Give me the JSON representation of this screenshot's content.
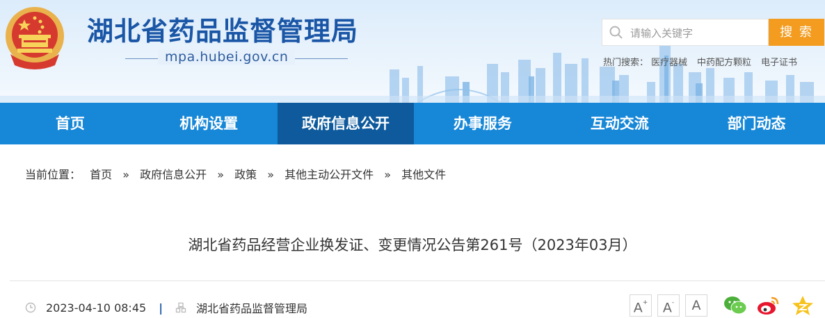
{
  "header": {
    "site_title": "湖北省药品监督管理局",
    "site_url": "mpa.hubei.gov.cn"
  },
  "search": {
    "placeholder": "请输入关键字",
    "button_label": "搜 索",
    "hot_label": "热门搜索：",
    "hot_items": [
      "医疗器械",
      "中药配方颗粒",
      "电子证书"
    ]
  },
  "nav": {
    "items": [
      {
        "label": "首页"
      },
      {
        "label": "机构设置"
      },
      {
        "label": "政府信息公开"
      },
      {
        "label": "办事服务"
      },
      {
        "label": "互动交流"
      },
      {
        "label": "部门动态"
      }
    ],
    "active": "政府信息公开"
  },
  "breadcrumb": {
    "prefix": "当前位置：",
    "separator": "»",
    "items": [
      "首页",
      "政府信息公开",
      "政策",
      "其他主动公开文件",
      "其他文件"
    ]
  },
  "article": {
    "title": "湖北省药品经营企业换发证、变更情况公告第261号（2023年03月）",
    "date": "2023-04-10 08:45",
    "meta_separator": "|",
    "source": "湖北省药品监督管理局"
  },
  "tools": {
    "font_larger": "A",
    "font_larger_mark": "+",
    "font_smaller": "A",
    "font_smaller_mark": "-",
    "font_reset": "A"
  },
  "colors": {
    "brand_blue": "#1787d7",
    "nav_active": "#0e5a9c",
    "search_orange": "#f39c1f",
    "title_blue": "#1a56a6"
  },
  "icons": [
    "national-emblem-icon",
    "search-icon",
    "clock-icon",
    "org-icon",
    "wechat-icon",
    "weibo-icon",
    "qzone-icon"
  ]
}
